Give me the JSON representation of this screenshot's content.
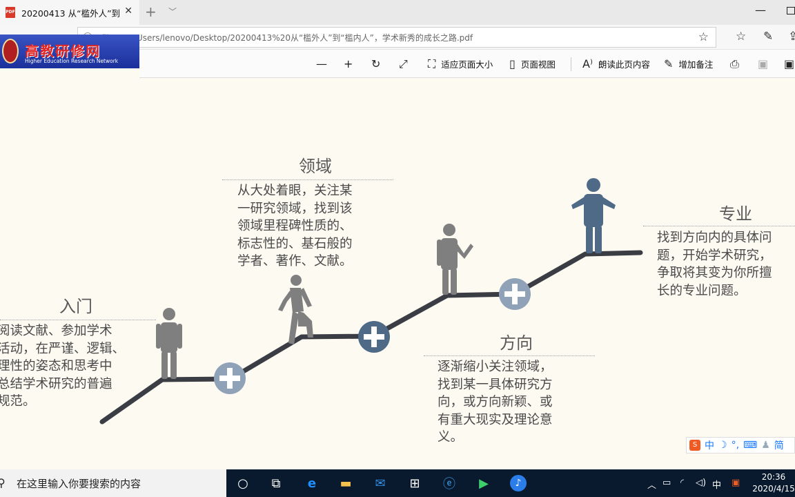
{
  "browser": {
    "tab_title": "20200413 从“槛外人”到",
    "tab_file_badge": "PDF",
    "url": "file:///C:/Users/lenovo/Desktop/20200413%20从“槛外人”到“槛内人”，学术新秀的成长之路.pdf"
  },
  "logo": {
    "title": "高教研修网",
    "subtitle": "Higher Education Research Network"
  },
  "pdf_toolbar": {
    "fit_page": "适应页面大小",
    "page_view": "页面视图",
    "read_aloud": "朗读此页内容",
    "add_notes": "增加备注"
  },
  "slide": {
    "stage1": {
      "title": "入门",
      "text": [
        "阅读文献、参加学术",
        "活动，在严谨、逻辑、",
        "理性的姿态和思考中",
        "总结学术研究的普遍",
        "规范。"
      ]
    },
    "stage2": {
      "title": "领域",
      "text": [
        "从大处着眼，关注某",
        "一研究领域，找到该",
        "领域里程碑性质的、",
        "标志性的、基石般的",
        "学者、著作、文献。"
      ]
    },
    "stage3": {
      "title": "方向",
      "text": [
        "逐渐缩小关注领域，",
        "找到某一具体研究方",
        "向，或方向新颖、或",
        "有重大现实及理论意",
        "义。"
      ]
    },
    "stage4": {
      "title": "专业",
      "text": [
        "找到方向内的具体问",
        "题，开始学术研究，",
        "争取将其变为你所擅",
        "长的专业问题。"
      ]
    },
    "colors": {
      "stairs": "#3b3d45",
      "person_gray": "#7f7f7f",
      "person_blue": "#4f6a87",
      "plus_light": "#8fa2b8",
      "plus_dark": "#4f6a87"
    }
  },
  "ime_bar": {
    "label_cn": "中",
    "label_simplified": "简"
  },
  "taskbar": {
    "search_placeholder": "在这里输入你要搜索的内容",
    "ime_indicator": "中",
    "time": "20:36",
    "date": "2020/4/15"
  }
}
